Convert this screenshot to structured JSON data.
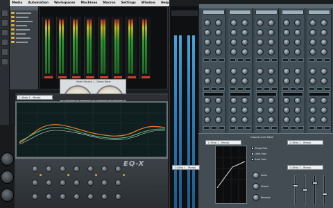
{
  "menu": {
    "items": [
      "Media",
      "Automation",
      "Workspaces",
      "Machines",
      "Macros",
      "Settings",
      "Window",
      "Help"
    ]
  },
  "vu": {
    "title": "Meter Window 1 - Stereo Meter"
  },
  "track_selectors": {
    "eq_track": "1 (Strip 1 - Mono)",
    "lower_track_left": "1 (Strip 1 - Mono)",
    "lower_track_mid": "1 (Strip 1 - Mono)",
    "lower_track_right": "1 (Strip 1 - Mono)",
    "lower_track_far": "1 (Strip 1 - Mono)"
  },
  "plugin": {
    "brand": "EQ-X"
  },
  "channel_strips": {
    "count": 5
  },
  "lower_panel": {
    "title": "Output Level Meter",
    "labels": [
      "Comp Fast",
      "Limit Fast",
      "Auto Gain",
      "Ratio",
      "Attack",
      "Release"
    ]
  },
  "colors": {
    "meter_green": "#2e9e2e",
    "meter_red": "#b51f1f",
    "meter_yellow": "#c9c21f",
    "eq_curve_orange": "#e07a2a",
    "eq_curve_green": "#5fbf7a",
    "master_blue": "#2f7fba",
    "folder_yellow": "#d9b13d"
  },
  "icons": [
    "folder-icon",
    "knob-icon",
    "vu-needle-icon"
  ]
}
